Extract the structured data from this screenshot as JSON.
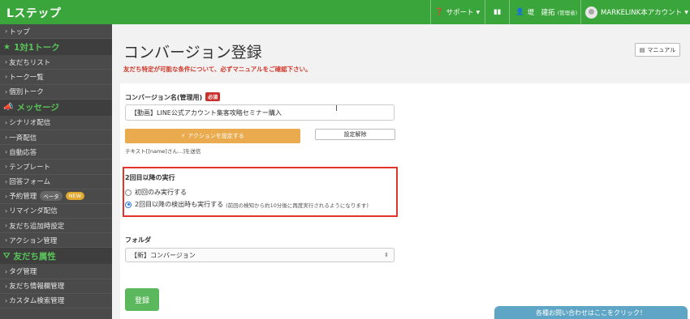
{
  "header": {
    "brand": "Lステップ",
    "support_label": "サポート",
    "user_name": "堤　建拓",
    "user_role": "(管理者)",
    "account_label": "MARKELINK本アカウント"
  },
  "sidebar": {
    "items": [
      {
        "type": "item",
        "label": "トップ"
      },
      {
        "type": "head",
        "label": "1対1トーク",
        "icon": "star-icon"
      },
      {
        "type": "item",
        "label": "友だちリスト"
      },
      {
        "type": "item",
        "label": "トーク一覧"
      },
      {
        "type": "item",
        "label": "個別トーク"
      },
      {
        "type": "head",
        "label": "メッセージ",
        "icon": "megaphone-icon"
      },
      {
        "type": "item",
        "label": "シナリオ配信"
      },
      {
        "type": "item",
        "label": "一斉配信"
      },
      {
        "type": "item",
        "label": "自動応答"
      },
      {
        "type": "item",
        "label": "テンプレート"
      },
      {
        "type": "item",
        "label": "回答フォーム"
      },
      {
        "type": "item",
        "label": "予約管理",
        "badges": [
          "ベータ",
          "NEW"
        ]
      },
      {
        "type": "item",
        "label": "リマインダ配信"
      },
      {
        "type": "item",
        "label": "友だち追加時設定"
      },
      {
        "type": "item",
        "label": "アクション管理"
      },
      {
        "type": "head",
        "label": "友だち属性",
        "icon": "filter-icon"
      },
      {
        "type": "item",
        "label": "タグ管理"
      },
      {
        "type": "item",
        "label": "友だち情報欄管理"
      },
      {
        "type": "item",
        "label": "カスタム検索管理"
      }
    ]
  },
  "main": {
    "title": "コンバージョン登録",
    "notice": "友だち特定が可能な条件について、必ずマニュアルをご確認下さい。",
    "manual_label": "マニュアル"
  },
  "form": {
    "name_label": "コンバージョン名(管理用)",
    "required_badge": "必須",
    "name_value": "【動画】LINE公式アカウント集客攻略セミナー購入",
    "action_button": "アクションを設定する",
    "reset_button": "設定解除",
    "send_note": "テキスト[[name]さん…]を送信",
    "repeat_label": "2回目以降の実行",
    "radio_first_only": "初回のみ実行する",
    "radio_every": "2回目以降の検出時も実行する",
    "radio_every_note": "(前回の検知から約10分後に再度実行されるようになります)",
    "folder_label": "フォルダ",
    "folder_value": "【新】コンバージョン",
    "submit_button": "登録"
  },
  "help_tab": "各種お問い合わせはここをクリック！",
  "colors": {
    "topbar": "#3aa53a",
    "sidebar": "#4a4a4a",
    "highlight": "#e0352b",
    "action": "#e9ab4e",
    "submit": "#5cb85c"
  }
}
